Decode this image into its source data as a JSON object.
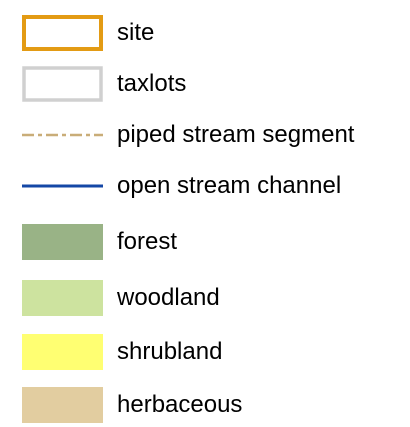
{
  "legend": {
    "items": [
      {
        "key": "site",
        "label": "site",
        "symbol": "outline-box",
        "color": "#e39b14",
        "fill": "#ffffff"
      },
      {
        "key": "taxlots",
        "label": "taxlots",
        "symbol": "outline-box",
        "color": "#d0d0d0",
        "fill": "#ffffff"
      },
      {
        "key": "piped",
        "label": "piped stream segment",
        "symbol": "dash-dot-line",
        "color": "#c9ad78"
      },
      {
        "key": "open",
        "label": "open stream channel",
        "symbol": "solid-line",
        "color": "#1447a6"
      },
      {
        "key": "forest",
        "label": "forest",
        "symbol": "filled-box",
        "color": "#99b386"
      },
      {
        "key": "woodland",
        "label": "woodland",
        "symbol": "filled-box",
        "color": "#cde39f"
      },
      {
        "key": "shrubland",
        "label": "shrubland",
        "symbol": "filled-box",
        "color": "#ffff72"
      },
      {
        "key": "herbaceous",
        "label": "herbaceous",
        "symbol": "filled-box",
        "color": "#e2cda0"
      }
    ]
  }
}
